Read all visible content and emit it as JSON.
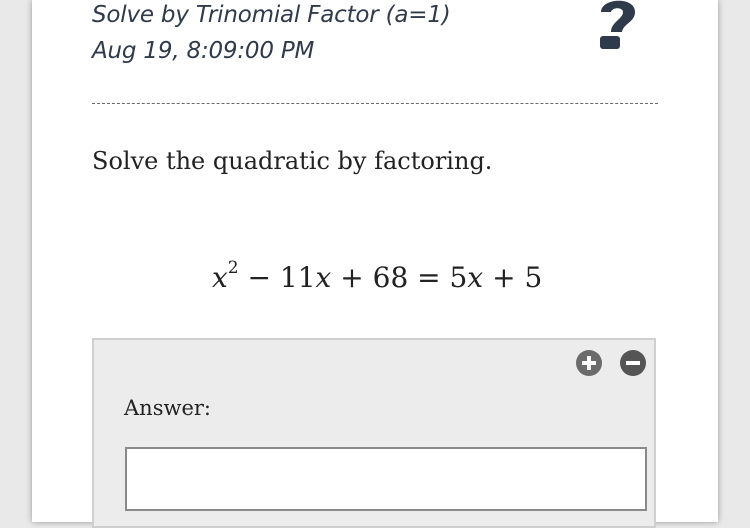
{
  "header": {
    "title": "Solve by Trinomial Factor (a=1)",
    "timestamp": "Aug 19, 8:09:00 PM",
    "help_icon": "question-mark-icon"
  },
  "question": {
    "instruction": "Solve the quadratic by factoring.",
    "equation": {
      "base": "x",
      "exponent": "2",
      "minus": "−",
      "coef1": "11",
      "var1": "x",
      "plus1": "+",
      "const1": "68",
      "equals": "=",
      "coef2": "5",
      "var2": "x",
      "plus2": "+",
      "const2": "5"
    }
  },
  "answer": {
    "label": "Answer:",
    "input_value": "",
    "add_icon": "plus-circle-icon",
    "remove_icon": "minus-circle-icon"
  },
  "colors": {
    "background": "#e9e9e9",
    "card": "#ffffff",
    "panel": "#ececec",
    "icon_dark": "#2f3a4a",
    "control": "#6b6b6b"
  }
}
